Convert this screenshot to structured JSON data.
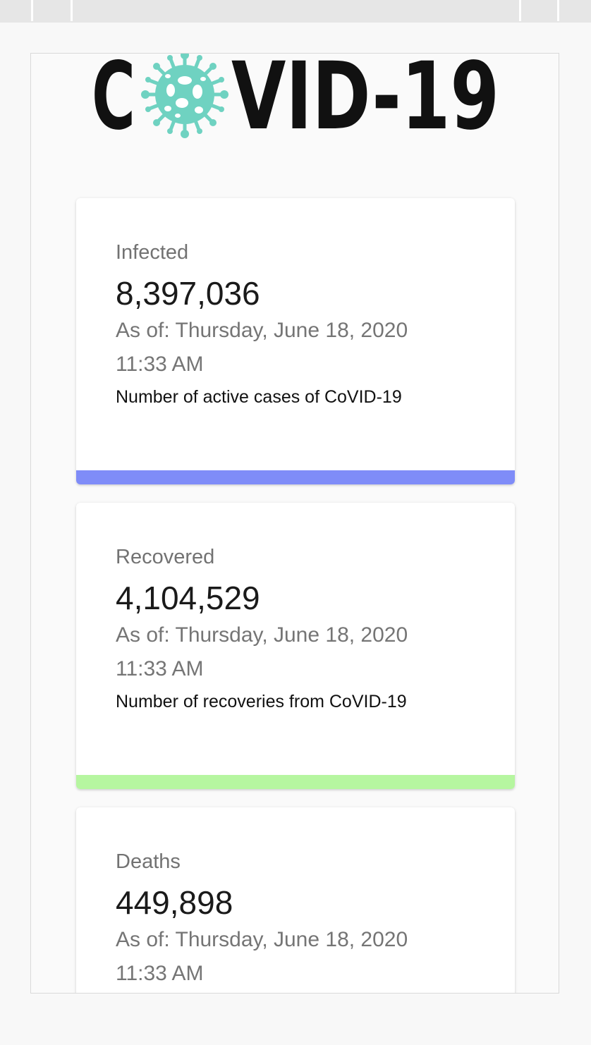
{
  "header": {
    "logo": {
      "text_left": "C",
      "text_right": "VID-19",
      "icon": "virus-icon",
      "text_color": "#111111",
      "icon_color": "#6fd2c1"
    }
  },
  "cards": [
    {
      "title": "Infected",
      "value": "8,397,036",
      "date": "As of: Thursday, June 18, 2020",
      "time": "11:33 AM",
      "description": "Number of active cases of CoVID-19",
      "accent_color": "#7f8cf8"
    },
    {
      "title": "Recovered",
      "value": "4,104,529",
      "date": "As of: Thursday, June 18, 2020",
      "time": "11:33 AM",
      "description": "Number of recoveries from CoVID-19",
      "accent_color": "#b6f6a0"
    },
    {
      "title": "Deaths",
      "value": "449,898",
      "date": "As of: Thursday, June 18, 2020",
      "time": "11:33 AM",
      "description": "",
      "accent_color": ""
    }
  ]
}
